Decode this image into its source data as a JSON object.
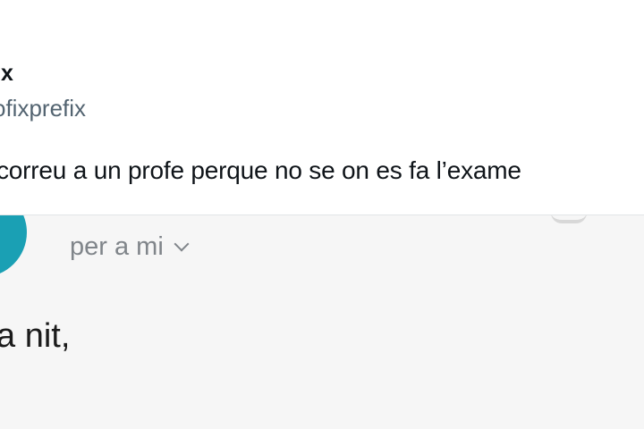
{
  "tweet": {
    "display_name": "ix",
    "handle": "ofixprefix",
    "text": "correu a un profe perque no se on es fa l’exame"
  },
  "email": {
    "recipient_line": "per a mi",
    "greeting": "a nit,",
    "body_partial": ""
  },
  "icons": {
    "recipient_dropdown": "chevron-down-icon",
    "avatar": "avatar"
  },
  "colors": {
    "avatar": "#1aa0b4",
    "handle": "#536471",
    "recipient": "#80858a"
  }
}
